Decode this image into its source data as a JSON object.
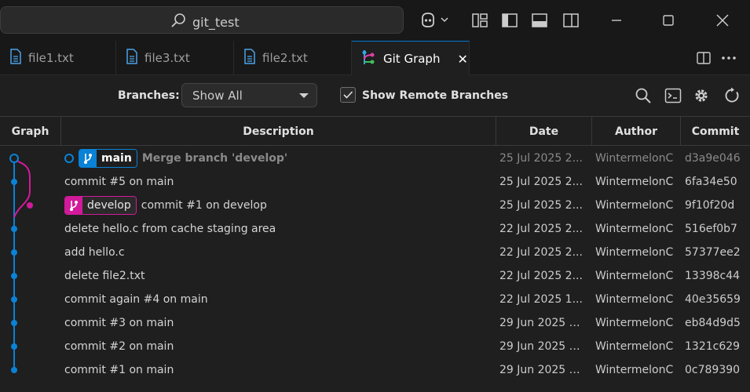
{
  "titlebar": {
    "search_text": "git_test"
  },
  "tabs": [
    {
      "label": "file1.txt",
      "icon": "file-icon"
    },
    {
      "label": "file3.txt",
      "icon": "file-icon"
    },
    {
      "label": "file2.txt",
      "icon": "file-icon"
    },
    {
      "label": "Git Graph",
      "icon": "git-graph-icon",
      "active": true
    }
  ],
  "tab_close": "✕",
  "controls": {
    "branches_label": "Branches:",
    "branches_value": "Show All",
    "show_remote_label": "Show Remote Branches",
    "show_remote_checked": true
  },
  "table": {
    "headers": [
      "Graph",
      "Description",
      "Date",
      "Author",
      "Commit"
    ],
    "rows": [
      {
        "message": "Merge branch 'develop'",
        "branch": "main",
        "date": "25 Jul 2025 2...",
        "author": "WintermelonC",
        "commit": "d3a9e046",
        "head": true
      },
      {
        "message": "commit #5 on main",
        "date": "25 Jul 2025 2...",
        "author": "WintermelonC",
        "commit": "6fa34e50"
      },
      {
        "message": "commit #1 on develop",
        "branch": "develop",
        "date": "25 Jul 2025 2...",
        "author": "WintermelonC",
        "commit": "9f10f20d"
      },
      {
        "message": "delete hello.c from cache staging area",
        "date": "22 Jul 2025 2...",
        "author": "WintermelonC",
        "commit": "516ef0b7"
      },
      {
        "message": "add hello.c",
        "date": "22 Jul 2025 2...",
        "author": "WintermelonC",
        "commit": "57377ee2"
      },
      {
        "message": "delete file2.txt",
        "date": "22 Jul 2025 2...",
        "author": "WintermelonC",
        "commit": "13398c44"
      },
      {
        "message": "commit again #4 on main",
        "date": "22 Jul 2025 1...",
        "author": "WintermelonC",
        "commit": "40e35659"
      },
      {
        "message": "commit #3 on main",
        "date": "29 Jun 2025 2...",
        "author": "WintermelonC",
        "commit": "eb84d9d5"
      },
      {
        "message": "commit #2 on main",
        "date": "29 Jun 2025 2...",
        "author": "WintermelonC",
        "commit": "1321c629"
      },
      {
        "message": "commit #1 on main",
        "date": "29 Jun 2025 2...",
        "author": "WintermelonC",
        "commit": "0c789390"
      }
    ]
  },
  "colors": {
    "main_branch": "#0a82d6",
    "develop_branch": "#d21a9b",
    "accent": "#0078d4"
  }
}
